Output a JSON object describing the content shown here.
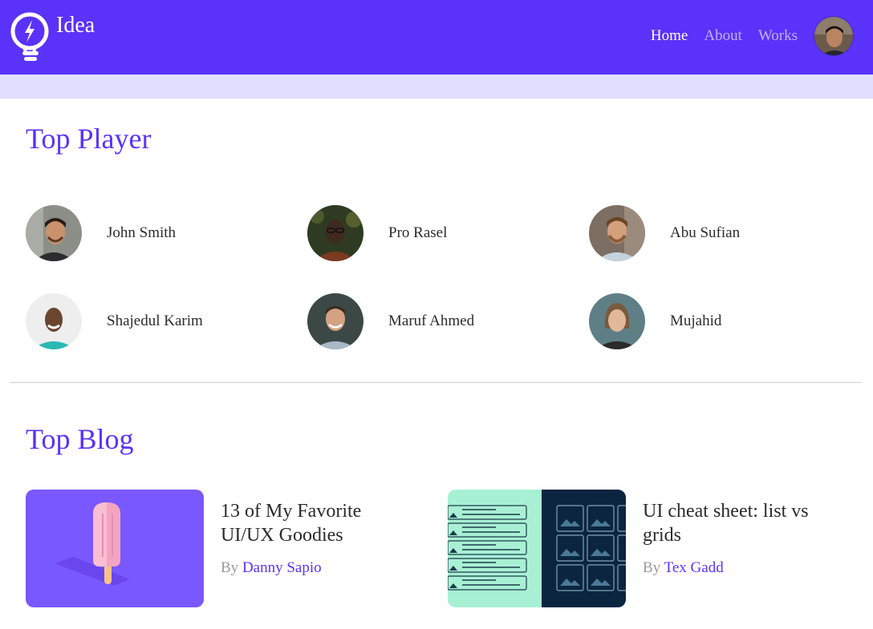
{
  "app": {
    "brand_name": "Idea",
    "accent_color": "#5a32fa",
    "band_color": "#e2deff"
  },
  "nav": {
    "items": [
      {
        "label": "Home",
        "active": true
      },
      {
        "label": "About",
        "active": false
      },
      {
        "label": "Works",
        "active": false
      }
    ]
  },
  "players": {
    "title": "Top Player",
    "items": [
      {
        "name": "John Smith"
      },
      {
        "name": "Pro Rasel"
      },
      {
        "name": "Abu Sufian"
      },
      {
        "name": "Shajedul Karim"
      },
      {
        "name": "Maruf Ahmed"
      },
      {
        "name": "Mujahid"
      }
    ]
  },
  "blog": {
    "title": "Top Blog",
    "by_label": "By",
    "posts": [
      {
        "title": "13 of My Favorite UI/UX Goodies",
        "author": "Danny Sapio"
      },
      {
        "title": "UI cheat sheet: list vs grids",
        "author": "Tex Gadd"
      }
    ]
  }
}
